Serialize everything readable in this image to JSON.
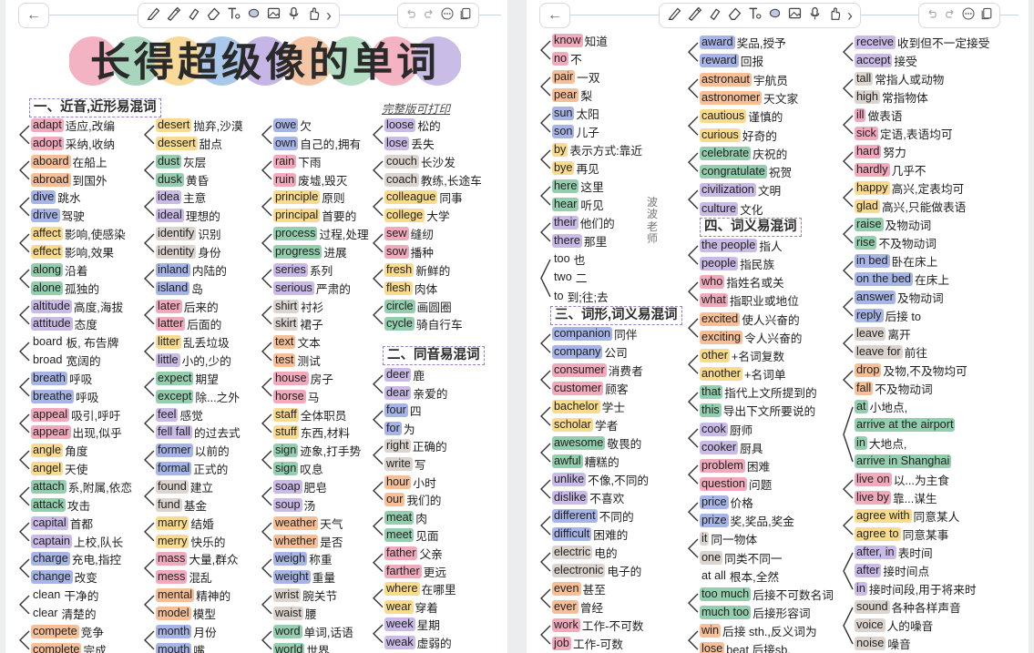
{
  "toolbar": {
    "back": "←",
    "more": "›"
  },
  "title": "长得超级像的单词",
  "title_bubbles": [
    "#f3b3c3",
    "#a8d5bc",
    "#f8d99a",
    "#a9c8ea",
    "#c5b6e6",
    "#f5c6a5",
    "#b5e0c5",
    "#f3b3c3",
    "#c9bde8"
  ],
  "left": {
    "sections": {
      "s1": "一、近音,近形易混词",
      "s2": "二、同音易混词"
    },
    "print_link": "完整版可打印",
    "col1": [
      {
        "w": "adapt",
        "m": "适应,改编",
        "c": "r"
      },
      {
        "w": "adopt",
        "m": "采纳,收纳",
        "c": "r"
      },
      {
        "w": "aboard",
        "m": "在船上",
        "c": "o"
      },
      {
        "w": "abroad",
        "m": "到国外",
        "c": "o"
      },
      {
        "w": "dive",
        "m": "跳水",
        "c": "b"
      },
      {
        "w": "drive",
        "m": "驾驶",
        "c": "b"
      },
      {
        "w": "affect",
        "m": "影响,使感染",
        "c": "y"
      },
      {
        "w": "effect",
        "m": "影响,效果",
        "c": "y"
      },
      {
        "w": "along",
        "m": "沿着",
        "c": "g"
      },
      {
        "w": "alone",
        "m": "孤独的",
        "c": "g"
      },
      {
        "w": "altitude",
        "m": "高度,海拔",
        "c": "p"
      },
      {
        "w": "attitude",
        "m": "态度",
        "c": "p"
      },
      {
        "w": "board",
        "m": "板, 布告牌",
        "c": "x"
      },
      {
        "w": "broad",
        "m": "宽阔的",
        "c": "x"
      },
      {
        "w": "breath",
        "m": "呼吸",
        "c": "b"
      },
      {
        "w": "breathe",
        "m": "呼吸",
        "c": "b"
      },
      {
        "w": "appeal",
        "m": "吸引,呼吁",
        "c": "r"
      },
      {
        "w": "appear",
        "m": "出现,似乎",
        "c": "r"
      },
      {
        "w": "angle",
        "m": "角度",
        "c": "y"
      },
      {
        "w": "angel",
        "m": "天使",
        "c": "y"
      },
      {
        "w": "attach",
        "m": "系,附属,依恋",
        "c": "g"
      },
      {
        "w": "attack",
        "m": "攻击",
        "c": "g"
      },
      {
        "w": "capital",
        "m": "首都",
        "c": "p"
      },
      {
        "w": "captain",
        "m": "上校,队长",
        "c": "p"
      },
      {
        "w": "charge",
        "m": "充电,指控",
        "c": "b"
      },
      {
        "w": "change",
        "m": "改变",
        "c": "b"
      },
      {
        "w": "clean",
        "m": "干净的",
        "c": "x"
      },
      {
        "w": "clear",
        "m": "清楚的",
        "c": "x"
      },
      {
        "w": "compete",
        "m": "竞争",
        "c": "o"
      },
      {
        "w": "complete",
        "m": "完成",
        "c": "o"
      }
    ],
    "col2": [
      {
        "w": "desert",
        "m": "抛弃,沙漠",
        "c": "y"
      },
      {
        "w": "dessert",
        "m": "甜点",
        "c": "y"
      },
      {
        "w": "dust",
        "m": "灰层",
        "c": "g"
      },
      {
        "w": "dusk",
        "m": "黄昏",
        "c": "g"
      },
      {
        "w": "idea",
        "m": "主意",
        "c": "p"
      },
      {
        "w": "ideal",
        "m": "理想的",
        "c": "p"
      },
      {
        "w": "identify",
        "m": "识别",
        "c": "n"
      },
      {
        "w": "identity",
        "m": "身份",
        "c": "n"
      },
      {
        "w": "inland",
        "m": "内陆的",
        "c": "b"
      },
      {
        "w": "island",
        "m": "岛",
        "c": "b"
      },
      {
        "w": "later",
        "m": "后来的",
        "c": "r"
      },
      {
        "w": "latter",
        "m": "后面的",
        "c": "r"
      },
      {
        "w": "litter",
        "m": "乱丢垃圾",
        "c": "y"
      },
      {
        "w": "little",
        "m": "小的,少的",
        "c": "p"
      },
      {
        "w": "expect",
        "m": "期望",
        "c": "g"
      },
      {
        "w": "except",
        "m": "除...之外",
        "c": "g"
      },
      {
        "w": "feel",
        "m": "感觉",
        "c": "p"
      },
      {
        "w": "fell fall",
        "m": "的过去式",
        "c": "p"
      },
      {
        "w": "former",
        "m": "以前的",
        "c": "b"
      },
      {
        "w": "formal",
        "m": "正式的",
        "c": "b"
      },
      {
        "w": "found",
        "m": "建立",
        "c": "n"
      },
      {
        "w": "fund",
        "m": "基金",
        "c": "n"
      },
      {
        "w": "marry",
        "m": "结婚",
        "c": "y"
      },
      {
        "w": "merry",
        "m": "快乐的",
        "c": "y"
      },
      {
        "w": "mass",
        "m": "大量,群众",
        "c": "r"
      },
      {
        "w": "mess",
        "m": "混乱",
        "c": "r"
      },
      {
        "w": "mental",
        "m": "精神的",
        "c": "o"
      },
      {
        "w": "model",
        "m": "模型",
        "c": "o"
      },
      {
        "w": "month",
        "m": "月份",
        "c": "b"
      },
      {
        "w": "mouth",
        "m": "嘴",
        "c": "b"
      }
    ],
    "col3": [
      {
        "w": "owe",
        "m": "欠",
        "c": "b"
      },
      {
        "w": "own",
        "m": "自己的,拥有",
        "c": "b"
      },
      {
        "w": "rain",
        "m": "下雨",
        "c": "r"
      },
      {
        "w": "ruin",
        "m": "废墟,毁灭",
        "c": "r"
      },
      {
        "w": "principle",
        "m": "原则",
        "c": "y"
      },
      {
        "w": "principal",
        "m": "首要的",
        "c": "y"
      },
      {
        "w": "process",
        "m": "过程,处理",
        "c": "g"
      },
      {
        "w": "progress",
        "m": "进展",
        "c": "g"
      },
      {
        "w": "series",
        "m": "系列",
        "c": "p"
      },
      {
        "w": "serious",
        "m": "严肃的",
        "c": "p"
      },
      {
        "w": "shirt",
        "m": "衬衫",
        "c": "n"
      },
      {
        "w": "skirt",
        "m": "裙子",
        "c": "n"
      },
      {
        "w": "text",
        "m": "文本",
        "c": "o"
      },
      {
        "w": "test",
        "m": "测试",
        "c": "o"
      },
      {
        "w": "house",
        "m": "房子",
        "c": "r"
      },
      {
        "w": "horse",
        "m": "马",
        "c": "r"
      },
      {
        "w": "staff",
        "m": "全体职员",
        "c": "y"
      },
      {
        "w": "stuff",
        "m": "东西,材料",
        "c": "y"
      },
      {
        "w": "sign",
        "m": "迹象,打手势",
        "c": "g"
      },
      {
        "w": "sign",
        "m": "叹息",
        "c": "g"
      },
      {
        "w": "soap",
        "m": "肥皂",
        "c": "p"
      },
      {
        "w": "soup",
        "m": "汤",
        "c": "p"
      },
      {
        "w": "weather",
        "m": "天气",
        "c": "o"
      },
      {
        "w": "whether",
        "m": "是否",
        "c": "o"
      },
      {
        "w": "weigh",
        "m": "称重",
        "c": "b"
      },
      {
        "w": "weight",
        "m": "重量",
        "c": "b"
      },
      {
        "w": "wrist",
        "m": "腕关节",
        "c": "n"
      },
      {
        "w": "waist",
        "m": "腰",
        "c": "n"
      },
      {
        "w": "word",
        "m": "单词,话语",
        "c": "g"
      },
      {
        "w": "world",
        "m": "世界",
        "c": "g"
      }
    ],
    "col4a": [
      {
        "w": "loose",
        "m": "松的",
        "c": "p"
      },
      {
        "w": "lose",
        "m": "丢失",
        "c": "p"
      },
      {
        "w": "couch",
        "m": "长沙发",
        "c": "n"
      },
      {
        "w": "coach",
        "m": "教练,长途车",
        "c": "n"
      },
      {
        "w": "colleague",
        "m": "同事",
        "c": "y"
      },
      {
        "w": "college",
        "m": "大学",
        "c": "y"
      },
      {
        "w": "sew",
        "m": "缝纫",
        "c": "r"
      },
      {
        "w": "sow",
        "m": "播种",
        "c": "r"
      },
      {
        "w": "fresh",
        "m": "新鲜的",
        "c": "y"
      },
      {
        "w": "flesh",
        "m": "肉体",
        "c": "y"
      },
      {
        "w": "circle",
        "m": "画圆圈",
        "c": "g"
      },
      {
        "w": "cycle",
        "m": "骑自行车",
        "c": "g"
      }
    ],
    "col4b": [
      {
        "w": "deer",
        "m": "鹿",
        "c": "p"
      },
      {
        "w": "dear",
        "m": "亲爱的",
        "c": "p"
      },
      {
        "w": "four",
        "m": "四",
        "c": "b"
      },
      {
        "w": "for",
        "m": "为",
        "c": "b"
      },
      {
        "w": "right",
        "m": "正确的",
        "c": "n"
      },
      {
        "w": "write",
        "m": "写",
        "c": "n"
      },
      {
        "w": "hour",
        "m": "小时",
        "c": "o"
      },
      {
        "w": "our",
        "m": "我们的",
        "c": "o"
      },
      {
        "w": "meat",
        "m": "肉",
        "c": "g"
      },
      {
        "w": "meet",
        "m": "见面",
        "c": "g"
      },
      {
        "w": "father",
        "m": "父亲",
        "c": "r"
      },
      {
        "w": "farther",
        "m": "更远",
        "c": "r"
      },
      {
        "w": "where",
        "m": "在哪里",
        "c": "y"
      },
      {
        "w": "wear",
        "m": "穿着",
        "c": "y"
      },
      {
        "w": "week",
        "m": "星期",
        "c": "p"
      },
      {
        "w": "weak",
        "m": "虚弱的",
        "c": "p"
      }
    ]
  },
  "right": {
    "sections": {
      "s3": "三、词形,词义易混词",
      "s4": "四、词义易混词"
    },
    "vertical_text": "波波老师",
    "col1a": [
      {
        "w": "know",
        "m": "知道",
        "c": "r"
      },
      {
        "w": "no",
        "m": "不",
        "c": "r"
      },
      {
        "w": "pair",
        "m": "一双",
        "c": "o"
      },
      {
        "w": "pear",
        "m": "梨",
        "c": "o"
      },
      {
        "w": "sun",
        "m": "太阳",
        "c": "b"
      },
      {
        "w": "son",
        "m": "儿子",
        "c": "b"
      },
      {
        "w": "by",
        "m": "表示方式:靠近",
        "c": "y"
      },
      {
        "w": "bye",
        "m": "再见",
        "c": "y"
      },
      {
        "w": "here",
        "m": "这里",
        "c": "g"
      },
      {
        "w": "hear",
        "m": "听见",
        "c": "g"
      },
      {
        "w": "their",
        "m": "他们的",
        "c": "p"
      },
      {
        "w": "there",
        "m": "那里",
        "c": "p"
      }
    ],
    "too_group": [
      {
        "w": "too",
        "m": "也",
        "c": "x"
      },
      {
        "w": "two",
        "m": "二",
        "c": "x"
      },
      {
        "w": "to",
        "m": "到;往;去",
        "c": "x"
      }
    ],
    "col1b": [
      {
        "w": "companion",
        "m": "同伴",
        "c": "b"
      },
      {
        "w": "company",
        "m": "公司",
        "c": "b"
      },
      {
        "w": "consumer",
        "m": "消费者",
        "c": "r"
      },
      {
        "w": "customer",
        "m": "顾客",
        "c": "r"
      },
      {
        "w": "bachelor",
        "m": "学士",
        "c": "y"
      },
      {
        "w": "scholar",
        "m": "学者",
        "c": "y"
      },
      {
        "w": "awesome",
        "m": "敬畏的",
        "c": "g"
      },
      {
        "w": "awful",
        "m": "糟糕的",
        "c": "g"
      },
      {
        "w": "unlike",
        "m": "不像,不同的",
        "c": "p"
      },
      {
        "w": "dislike",
        "m": "不喜欢",
        "c": "p"
      },
      {
        "w": "different",
        "m": "不同的",
        "c": "b"
      },
      {
        "w": "difficult",
        "m": "困难的",
        "c": "b"
      },
      {
        "w": "electric",
        "m": "电的",
        "c": "n"
      },
      {
        "w": "electronic",
        "m": "电子的",
        "c": "n"
      },
      {
        "w": "even",
        "m": "甚至",
        "c": "o"
      },
      {
        "w": "ever",
        "m": "曾经",
        "c": "o"
      },
      {
        "w": "work",
        "m": "工作-不可数",
        "c": "r"
      },
      {
        "w": "job",
        "m": "工作-可数",
        "c": "r"
      }
    ],
    "col2a": [
      {
        "w": "award",
        "m": "奖品,授予",
        "c": "b"
      },
      {
        "w": "reward",
        "m": "回报",
        "c": "b"
      },
      {
        "w": "astronaut",
        "m": "宇航员",
        "c": "o"
      },
      {
        "w": "astronomer",
        "m": "天文家",
        "c": "o"
      },
      {
        "w": "cautious",
        "m": "谨慎的",
        "c": "y"
      },
      {
        "w": "curious",
        "m": "好奇的",
        "c": "y"
      },
      {
        "w": "celebrate",
        "m": "庆祝的",
        "c": "g"
      },
      {
        "w": "congratulate",
        "m": "祝贺",
        "c": "g"
      },
      {
        "w": "civilization",
        "m": "文明",
        "c": "p"
      },
      {
        "w": "culture",
        "m": "文化",
        "c": "p"
      }
    ],
    "col2b": [
      {
        "w": "the people",
        "m": "指人",
        "c": "p"
      },
      {
        "w": "people",
        "m": "指民族",
        "c": "p"
      },
      {
        "w": "who",
        "m": "指姓名或关",
        "c": "r"
      },
      {
        "w": "what",
        "m": "指职业或地位",
        "c": "r"
      },
      {
        "w": "excited",
        "m": "使人兴奋的",
        "c": "o"
      },
      {
        "w": "exciting",
        "m": "令人兴奋的",
        "c": "o"
      },
      {
        "w": "other",
        "m": "+名词复数",
        "c": "y"
      },
      {
        "w": "another",
        "m": "+名词单",
        "c": "y"
      },
      {
        "w": "that",
        "m": "指代上文所提到的",
        "c": "g"
      },
      {
        "w": "this",
        "m": "导出下文所要说的",
        "c": "g"
      },
      {
        "w": "cook",
        "m": "厨师",
        "c": "p"
      },
      {
        "w": "cooker",
        "m": "厨具",
        "c": "p"
      },
      {
        "w": "problem",
        "m": "困难",
        "c": "r"
      },
      {
        "w": "question",
        "m": "问题",
        "c": "r"
      },
      {
        "w": "price",
        "m": "价格",
        "c": "b"
      },
      {
        "w": "prize",
        "m": "奖,奖品,奖金",
        "c": "b"
      },
      {
        "w": "it",
        "m": "同一物体",
        "c": "n"
      },
      {
        "w": "one",
        "m": "同类不同一",
        "c": "n"
      },
      {
        "w": "at all",
        "m": "根本,全然",
        "c": "x"
      },
      {
        "w": "too much",
        "m": "后接不可数名词",
        "c": "g"
      },
      {
        "w": "much too",
        "m": "后接形容词",
        "c": "g"
      },
      {
        "w": "win",
        "m": "后接 sth.,反义词为",
        "c": "o"
      },
      {
        "w": "lose",
        "m": "beat 后接sb.",
        "c": "o"
      }
    ],
    "col3a": [
      {
        "w": "receive",
        "m": "收到但不一定接受",
        "c": "p"
      },
      {
        "w": "accept",
        "m": "接受",
        "c": "p"
      },
      {
        "w": "tall",
        "m": "常指人或动物",
        "c": "n"
      },
      {
        "w": "high",
        "m": "常指物体",
        "c": "n"
      },
      {
        "w": "ill",
        "m": "做表语",
        "c": "r"
      },
      {
        "w": "sick",
        "m": "定语,表语均可",
        "c": "r"
      },
      {
        "w": "hard",
        "m": "努力",
        "c": "r"
      },
      {
        "w": "hardly",
        "m": "几乎不",
        "c": "r"
      },
      {
        "w": "happy",
        "m": "高兴,定表均可",
        "c": "y"
      },
      {
        "w": "glad",
        "m": "高兴,只能做表语",
        "c": "y"
      },
      {
        "w": "raise",
        "m": "及物动词",
        "c": "g"
      },
      {
        "w": "rise",
        "m": "不及物动词",
        "c": "g"
      },
      {
        "w": "in bed",
        "m": "卧在床上",
        "c": "b"
      },
      {
        "w": "on the bed",
        "m": "在床上",
        "c": "b"
      },
      {
        "w": "answer",
        "m": "及物动词",
        "c": "b"
      },
      {
        "w": "reply",
        "m": "后接 to",
        "c": "b"
      },
      {
        "w": "leave",
        "m": "离开",
        "c": "n"
      },
      {
        "w": "leave for",
        "m": "前往",
        "c": "n"
      },
      {
        "w": "drop",
        "m": "及物,不及物均可",
        "c": "o"
      },
      {
        "w": "fall",
        "m": "不及物动词",
        "c": "o"
      },
      {
        "w": "at",
        "m": "小地点,",
        "c": "g"
      },
      {
        "w": "arrive at the airport",
        "m": "",
        "c": "g"
      },
      {
        "w": "in",
        "m": "大地点,",
        "c": "g"
      },
      {
        "w": "arrive in Shanghai",
        "m": "",
        "c": "g"
      },
      {
        "w": "live on",
        "m": "以...为主食",
        "c": "r"
      },
      {
        "w": "live by",
        "m": "靠...谋生",
        "c": "r"
      },
      {
        "w": "agree with",
        "m": "同意某人",
        "c": "y"
      },
      {
        "w": "agree to",
        "m": "同意某事",
        "c": "y"
      },
      {
        "w": "after, in",
        "m": "表时间",
        "c": "p"
      },
      {
        "w": "after",
        "m": "接时间点",
        "c": "p"
      },
      {
        "w": "in",
        "m": "接时间段,用于将来时",
        "c": "p"
      },
      {
        "w": "sound",
        "m": "各种各样声音",
        "c": "n"
      },
      {
        "w": "voice",
        "m": "人的噪音",
        "c": "n"
      },
      {
        "w": "noise",
        "m": "噪音",
        "c": "n"
      }
    ]
  }
}
